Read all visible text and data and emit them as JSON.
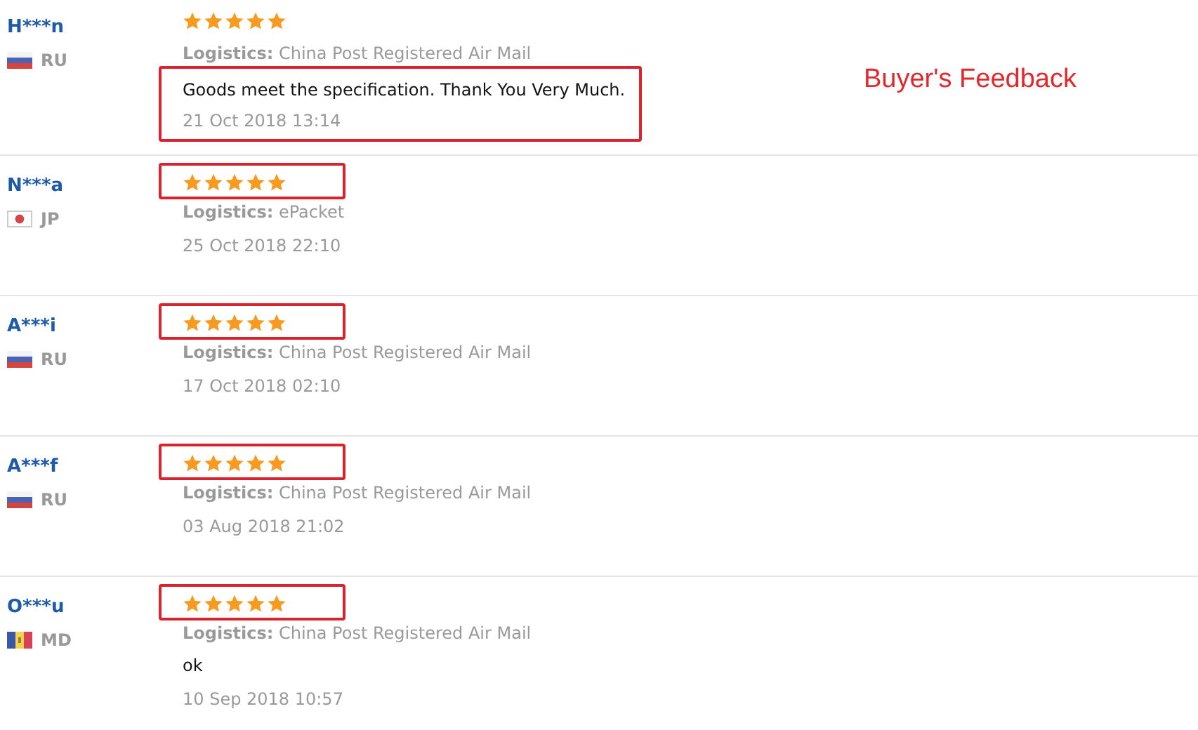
{
  "annotation": "Buyer's Feedback",
  "reviews": [
    {
      "name": "H***n",
      "kind": "russia",
      "country": "RU",
      "stars": 5,
      "logistics_label": "Logistics:",
      "logistics": "China Post Registered Air Mail",
      "comment": "Goods meet the specification. Thank You Very Much.",
      "date": "21 Oct 2018 13:14",
      "stars_highlighted": false,
      "comment_highlighted": true
    },
    {
      "name": "N***a",
      "kind": "japan",
      "country": "JP",
      "stars": 5,
      "logistics_label": "Logistics:",
      "logistics": "ePacket",
      "date": "25 Oct 2018 22:10",
      "stars_highlighted": true,
      "comment_highlighted": false
    },
    {
      "name": "A***i",
      "kind": "russia",
      "country": "RU",
      "stars": 5,
      "logistics_label": "Logistics:",
      "logistics": "China Post Registered Air Mail",
      "date": "17 Oct 2018 02:10",
      "stars_highlighted": true,
      "comment_highlighted": false
    },
    {
      "name": "A***f",
      "kind": "russia",
      "country": "RU",
      "stars": 5,
      "logistics_label": "Logistics:",
      "logistics": "China Post Registered Air Mail",
      "date": "03 Aug 2018 21:02",
      "stars_highlighted": true,
      "comment_highlighted": false
    },
    {
      "name": "O***u",
      "kind": "moldova",
      "country": "MD",
      "stars": 5,
      "logistics_label": "Logistics:",
      "logistics": "China Post Registered Air Mail",
      "comment": "ok",
      "date": "10 Sep 2018 10:57",
      "stars_highlighted": true,
      "comment_highlighted": false
    }
  ]
}
